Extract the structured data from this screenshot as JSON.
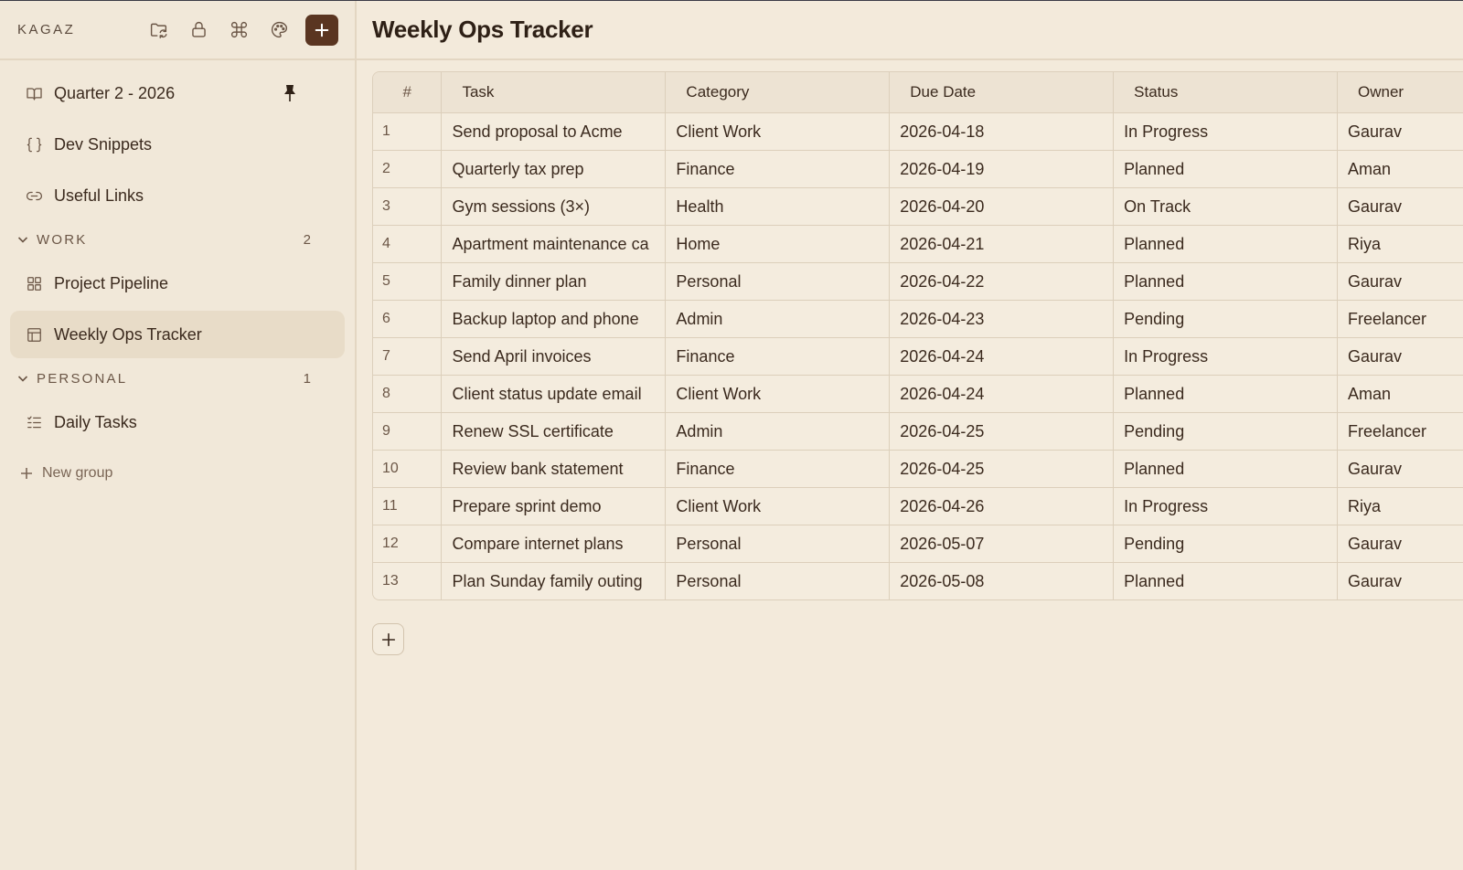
{
  "sidebar": {
    "brand": "KAGAZ",
    "pinned": [
      {
        "label": "Quarter 2 - 2026",
        "icon": "book-icon",
        "pinned": true
      },
      {
        "label": "Dev Snippets",
        "icon": "braces-icon"
      },
      {
        "label": "Useful Links",
        "icon": "link-icon"
      }
    ],
    "groups": [
      {
        "name": "WORK",
        "count": "2",
        "items": [
          {
            "label": "Project Pipeline",
            "icon": "grid-icon"
          },
          {
            "label": "Weekly Ops Tracker",
            "icon": "table-icon",
            "active": true
          }
        ]
      },
      {
        "name": "PERSONAL",
        "count": "1",
        "items": [
          {
            "label": "Daily Tasks",
            "icon": "checklist-icon"
          }
        ]
      }
    ],
    "new_group": "New group"
  },
  "main": {
    "title": "Weekly Ops Tracker",
    "columns": [
      "#",
      "Task",
      "Category",
      "Due Date",
      "Status",
      "Owner"
    ],
    "rows": [
      [
        "1",
        "Send proposal to Acme",
        "Client Work",
        "2026-04-18",
        "In Progress",
        "Gaurav"
      ],
      [
        "2",
        "Quarterly tax prep",
        "Finance",
        "2026-04-19",
        "Planned",
        "Aman"
      ],
      [
        "3",
        "Gym sessions (3×)",
        "Health",
        "2026-04-20",
        "On Track",
        "Gaurav"
      ],
      [
        "4",
        "Apartment maintenance ca",
        "Home",
        "2026-04-21",
        "Planned",
        "Riya"
      ],
      [
        "5",
        "Family dinner plan",
        "Personal",
        "2026-04-22",
        "Planned",
        "Gaurav"
      ],
      [
        "6",
        "Backup laptop and phone",
        "Admin",
        "2026-04-23",
        "Pending",
        "Freelancer"
      ],
      [
        "7",
        "Send April invoices",
        "Finance",
        "2026-04-24",
        "In Progress",
        "Gaurav"
      ],
      [
        "8",
        "Client status update email",
        "Client Work",
        "2026-04-24",
        "Planned",
        "Aman"
      ],
      [
        "9",
        "Renew SSL certificate",
        "Admin",
        "2026-04-25",
        "Pending",
        "Freelancer"
      ],
      [
        "10",
        "Review bank statement",
        "Finance",
        "2026-04-25",
        "Planned",
        "Gaurav"
      ],
      [
        "11",
        "Prepare sprint demo",
        "Client Work",
        "2026-04-26",
        "In Progress",
        "Riya"
      ],
      [
        "12",
        "Compare internet plans",
        "Personal",
        "2026-05-07",
        "Pending",
        "Gaurav"
      ],
      [
        "13",
        "Plan Sunday family outing",
        "Personal",
        "2026-05-08",
        "Planned",
        "Gaurav"
      ]
    ]
  },
  "colors": {
    "accent": "#5a3521",
    "background": "#f3eadb",
    "sidebar_active": "#e8dcc8",
    "border": "#dccfbb"
  }
}
